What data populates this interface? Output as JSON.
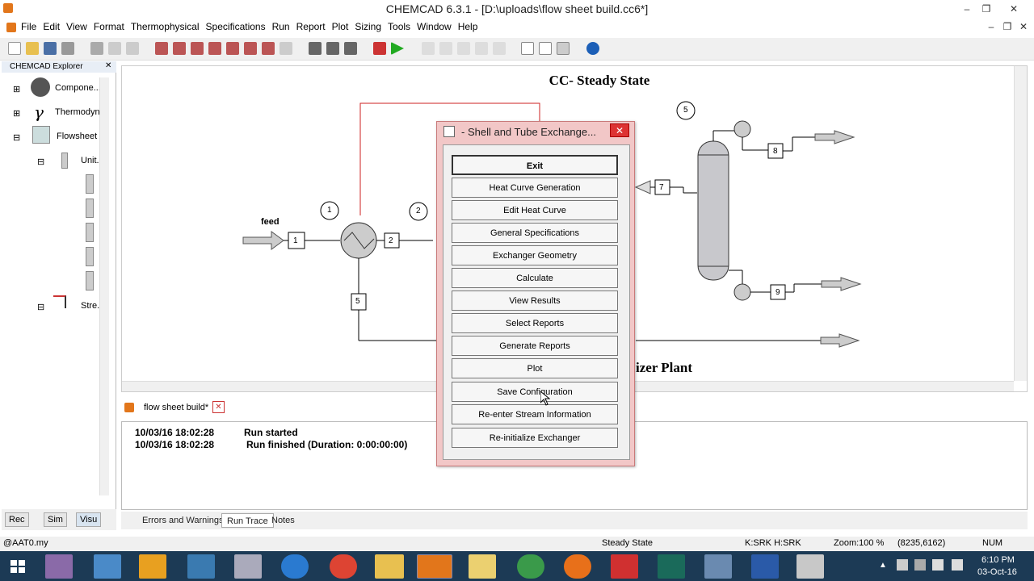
{
  "window": {
    "title": "CHEMCAD 6.3.1 - [D:\\uploads\\flow sheet build.cc6*]"
  },
  "menu": [
    "File",
    "Edit",
    "View",
    "Format",
    "Thermophysical",
    "Specifications",
    "Run",
    "Report",
    "Plot",
    "Sizing",
    "Tools",
    "Window",
    "Help"
  ],
  "explorer": {
    "title": "CHEMCAD Explorer",
    "items": [
      {
        "label": "Compone..."
      },
      {
        "label": "Thermodyn"
      },
      {
        "label": "Flowsheet"
      },
      {
        "label": "Unit..."
      },
      {
        "label": "Stre..."
      }
    ],
    "bottom_tabs": [
      "Rec",
      "Sim",
      "Visu"
    ]
  },
  "canvas": {
    "heading": "CC- Steady State",
    "subtitle_fragment": "izer Plant",
    "labels": {
      "feed": "feed",
      "unit1": "1",
      "unit2": "2",
      "unit5": "5",
      "s1": "1",
      "s2": "2",
      "s5": "5",
      "s7": "7",
      "s8": "8",
      "s9": "9"
    }
  },
  "document_tab": "flow sheet build*",
  "log": {
    "lines": [
      {
        "time": "10/03/16 18:02:28",
        "msg": "Run started"
      },
      {
        "time": "10/03/16 18:02:28",
        "msg": "Run finished (Duration: 0:00:00:00)"
      }
    ]
  },
  "log_tabs": [
    "Errors and Warnings",
    "Run Trace",
    "Notes"
  ],
  "status": {
    "left": "@AAT0.my",
    "mode": "Steady State",
    "thermo": "K:SRK H:SRK",
    "zoom": "Zoom:100 %",
    "coords": "(8235,6162)",
    "num": "NUM"
  },
  "dialog": {
    "title": "- Shell and Tube Exchange...",
    "buttons": [
      "Exit",
      "Heat Curve Generation",
      "Edit Heat Curve",
      "General Specifications",
      "Exchanger Geometry",
      "Calculate",
      "View Results",
      "Select Reports",
      "Generate Reports",
      "Plot",
      "Save Configuration",
      "Re-enter Stream Information",
      "Re-initialize Exchanger"
    ]
  },
  "taskbar": {
    "time": "6:10 PM",
    "date": "03-Oct-16"
  },
  "colors": {
    "dialog_frame": "#f2c7c7",
    "taskbar": "#1c3a55",
    "recycle_line": "#cc2222"
  }
}
